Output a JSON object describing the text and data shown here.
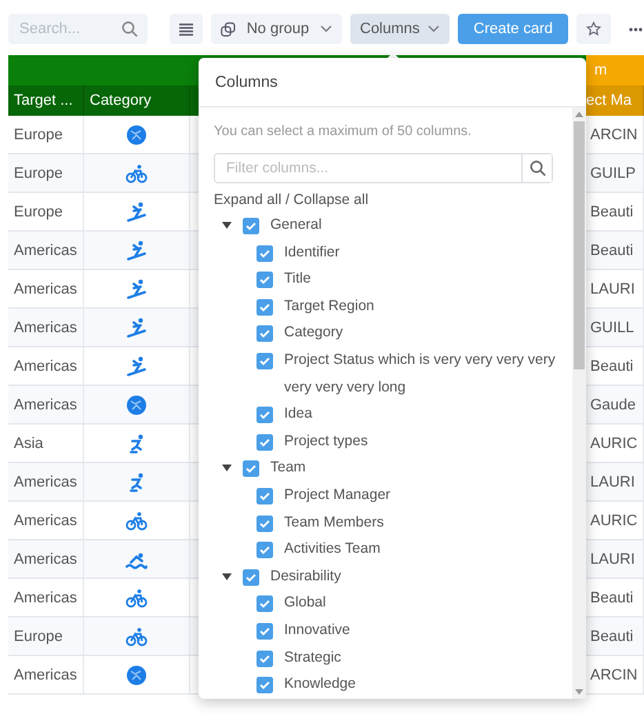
{
  "toolbar": {
    "search": {
      "placeholder": "Search..."
    },
    "group_button": "No group",
    "columns_button": "Columns",
    "create_button": "Create card"
  },
  "table": {
    "groups": [
      {
        "color": "#0a800a"
      },
      {
        "label": "m",
        "color": "#f5a800"
      }
    ],
    "columns": [
      {
        "label": "Target ..."
      },
      {
        "label": "Category"
      },
      {
        "label": "ect Ma"
      }
    ],
    "rows": [
      {
        "region": "Europe",
        "category": {
          "kind": "ball"
        },
        "column_3": "ARCIN"
      },
      {
        "region": "Europe",
        "category": {
          "kind": "bike"
        },
        "column_3": "GUILP"
      },
      {
        "region": "Europe",
        "category": {
          "kind": "snowboard"
        },
        "column_3": "Beauti"
      },
      {
        "region": "Americas",
        "category": {
          "kind": "snowboard"
        },
        "column_3": "Beauti"
      },
      {
        "region": "Americas",
        "category": {
          "kind": "snowboard"
        },
        "column_3": "LAURI"
      },
      {
        "region": "Americas",
        "category": {
          "kind": "snowboard"
        },
        "column_3": "GUILL"
      },
      {
        "region": "Americas",
        "category": {
          "kind": "snowboard"
        },
        "column_3": "Beauti"
      },
      {
        "region": "Americas",
        "category": {
          "kind": "ball"
        },
        "column_3": "Gaude"
      },
      {
        "region": "Asia",
        "category": {
          "kind": "skate"
        },
        "column_3": "AURIC"
      },
      {
        "region": "Americas",
        "category": {
          "kind": "skate"
        },
        "column_3": "LAURI"
      },
      {
        "region": "Americas",
        "category": {
          "kind": "bike"
        },
        "column_3": "AURIC"
      },
      {
        "region": "Americas",
        "category": {
          "kind": "swim"
        },
        "column_3": "LAURI"
      },
      {
        "region": "Americas",
        "category": {
          "kind": "bike"
        },
        "column_3": "Beauti"
      },
      {
        "region": "Europe",
        "category": {
          "kind": "bike"
        },
        "column_3": "Beauti"
      },
      {
        "region": "Americas",
        "category": {
          "kind": "ball"
        },
        "column_3": "ARCIN"
      }
    ]
  },
  "columns_popover": {
    "title": "Columns",
    "note": "You can select a maximum of 50 columns.",
    "filter": {
      "placeholder": "Filter columns..."
    },
    "expand_link": "Expand all / Collapse all",
    "groups": [
      {
        "label": "General",
        "checked": true,
        "expanded": true,
        "children": [
          {
            "label": "Identifier",
            "checked": true
          },
          {
            "label": "Title",
            "checked": true
          },
          {
            "label": "Target Region",
            "checked": true
          },
          {
            "label": "Category",
            "checked": true
          },
          {
            "label": "Project Status which is very very very very very very very long",
            "checked": true
          },
          {
            "label": "Idea",
            "checked": true
          },
          {
            "label": "Project types",
            "checked": true
          }
        ]
      },
      {
        "label": "Team",
        "checked": true,
        "expanded": true,
        "children": [
          {
            "label": "Project Manager",
            "checked": true
          },
          {
            "label": "Team Members",
            "checked": true
          },
          {
            "label": "Activities Team",
            "checked": true
          }
        ]
      },
      {
        "label": "Desirability",
        "checked": true,
        "expanded": true,
        "children": [
          {
            "label": "Global",
            "checked": true
          },
          {
            "label": "Innovative",
            "checked": true
          },
          {
            "label": "Strategic",
            "checked": true
          },
          {
            "label": "Knowledge",
            "checked": true
          }
        ]
      }
    ]
  }
}
